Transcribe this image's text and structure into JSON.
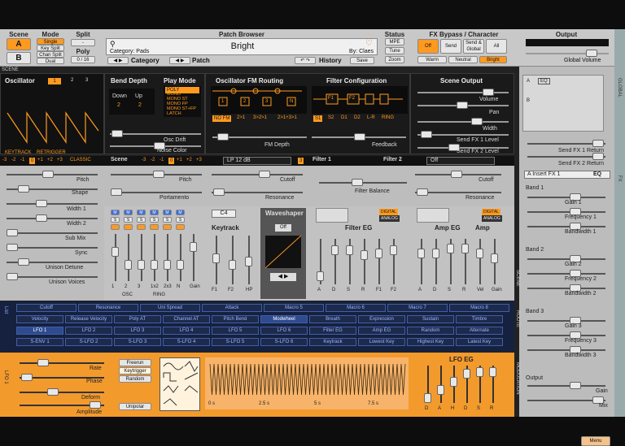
{
  "scene": {
    "title": "Scene",
    "a": "A",
    "b": "B"
  },
  "mode": {
    "title": "Mode",
    "options": [
      "Single",
      "Key Split",
      "Chan Split",
      "Dual"
    ]
  },
  "split": {
    "title": "Split",
    "value": "-",
    "poly_label": "Poly",
    "poly_value": "0 / 16"
  },
  "patch_browser": {
    "title": "Patch Browser",
    "patch_name": "Bright",
    "category_line": "Category: Pads",
    "author_line": "By: Claes",
    "category_label": "Category",
    "patch_label": "Patch",
    "history_label": "History",
    "save_label": "Save"
  },
  "status": {
    "title": "Status",
    "items": [
      "MPE",
      "Tune",
      "Zoom"
    ]
  },
  "fx_bypass": {
    "title": "FX Bypass / Character",
    "options": [
      "Off",
      "Send",
      "Send & Global",
      "All"
    ],
    "character": [
      "Warm",
      "Neutral",
      "Bright"
    ]
  },
  "output": {
    "title": "Output",
    "global_volume": "Global Volume"
  },
  "scene_strip_label": "SCENE",
  "oscillator": {
    "title": "Oscillator",
    "tabs": [
      "1",
      "2",
      "3"
    ],
    "keytrack": "KEYTRACK",
    "retrigger": "RETRIGGER",
    "octaves": [
      "-3",
      "-2",
      "-1",
      "0",
      "+1",
      "+2",
      "+3"
    ],
    "type": "CLASSIC",
    "params": [
      "Pitch",
      "Shape",
      "Width 1",
      "Width 2",
      "Sub Mix",
      "Sync",
      "Unison Detune",
      "Unison Voices"
    ]
  },
  "bend": {
    "title": "Bend Depth",
    "down": "Down",
    "up": "Up",
    "down_val": "2",
    "up_val": "2"
  },
  "play_mode": {
    "title": "Play Mode",
    "options": [
      "POLY",
      "MONO",
      "MONO ST",
      "MONO FP",
      "MONO ST+FP",
      "LATCH"
    ]
  },
  "osc_drift": "Osc Drift",
  "noise_color": "Noise Color",
  "fm_routing": {
    "title": "Oscillator FM Routing",
    "options": [
      "NO FM",
      "2>1",
      "3>2>1",
      "2>1+3>1"
    ],
    "fm_depth": "FM Depth",
    "nodes": [
      "1",
      "2",
      "3",
      "N"
    ]
  },
  "filter_config": {
    "title": "Filter Configuration",
    "options": [
      "S1",
      "S2",
      "D1",
      "D2",
      "L-R",
      "RING"
    ],
    "feedback": "Feedback",
    "nodes": [
      "F1",
      "F2"
    ]
  },
  "scene_output": {
    "title": "Scene Output",
    "params": [
      "Volume",
      "Pan",
      "Width",
      "Send FX 1 Level",
      "Send FX 2 Level"
    ]
  },
  "scene_bar": {
    "scene": "Scene",
    "octaves": [
      "-3",
      "-2",
      "-1",
      "0",
      "+1",
      "+2",
      "+3"
    ],
    "filter_type": "LP 12 dB",
    "filter_num": "3",
    "filter1": "Filter 1",
    "filter2": "Filter 2",
    "filter2_type": "Off"
  },
  "scene_params": {
    "pitch": "Pitch",
    "portamento": "Portamento",
    "cutoff": "Cutoff",
    "resonance": "Resonance",
    "filter_balance": "Filter Balance",
    "cutoff2": "Cutoff",
    "resonance2": "Resonance"
  },
  "mixer": {
    "m": "M",
    "s": "S",
    "labels": [
      "1",
      "2",
      "3",
      "1x2",
      "2x3",
      "N",
      "Gain"
    ],
    "osc": "OSC",
    "ring": "RING"
  },
  "keytrack": {
    "note": "C4",
    "title": "Keytrack",
    "labels": [
      "F1",
      "F2",
      "HP"
    ]
  },
  "waveshaper": {
    "title": "Waveshaper",
    "type": "Off"
  },
  "filter_eg": {
    "title": "Filter EG",
    "digital": "DIGITAL",
    "analog": "ANALOG",
    "labels": [
      "A",
      "D",
      "S",
      "R",
      "F1",
      "F2"
    ]
  },
  "amp_eg": {
    "title": "Amp EG",
    "subtitle": "Amp",
    "digital": "DIGITAL",
    "analog": "ANALOG",
    "labels": [
      "A",
      "D",
      "S",
      "R",
      "Vel",
      "Gain"
    ]
  },
  "fx": {
    "insert": "A Insert FX 1",
    "eq": "EQ",
    "bands": [
      {
        "name": "Band 1",
        "params": [
          "Gain 1",
          "Frequency 1",
          "Bandwidth 1"
        ]
      },
      {
        "name": "Band 2",
        "params": [
          "Gain 2",
          "Frequency 2",
          "Bandwidth 2"
        ]
      },
      {
        "name": "Band 3",
        "params": [
          "Gain 3",
          "Frequency 3",
          "Bandwidth 3"
        ]
      }
    ],
    "output": "Output",
    "gain": "Gain",
    "mix": "Mix",
    "send1": "Send FX 1 Return",
    "send2": "Send FX 2 Return",
    "menu": "Menu"
  },
  "mod_list": {
    "vertical": "List",
    "row1": [
      "Cutoff",
      "Resonance",
      "Uni Spread",
      "Attack",
      "Macro 5",
      "Macro 6",
      "Macro 7",
      "Macro 8"
    ],
    "row2": [
      "Velocity",
      "Release Velocity",
      "Poly AT",
      "Channel AT",
      "Pitch Bend",
      "Modwheel",
      "Breath",
      "Expression",
      "Sustain",
      "Timbre"
    ],
    "row3": [
      "LFO 1",
      "LFO 2",
      "LFO 3",
      "LFO 4",
      "LFO 5",
      "LFO 6",
      "Filter EG",
      "Amp EG",
      "Random",
      "Alternate"
    ],
    "row4": [
      "S-ENV 1",
      "S-LFO 2",
      "S-LFO 3",
      "S-LFO 4",
      "S-LFO 5",
      "S-LFO 6",
      "Keytrack",
      "Lowest Key",
      "Highest Key",
      "Latest Key"
    ]
  },
  "lfo": {
    "vertical": "LFO 1",
    "params": [
      "Rate",
      "Phase",
      "Deform",
      "Amplitude"
    ],
    "modes": [
      "Freerun",
      "Keytrigger",
      "Random"
    ],
    "unipolar": "Unipolar",
    "time_labels": [
      "0 s",
      "2.5 s",
      "5 s",
      "7.5 s"
    ],
    "eg_title": "LFO EG",
    "eg_labels": [
      "D",
      "A",
      "H",
      "D",
      "S",
      "R"
    ]
  },
  "side_labels": {
    "global": "GLOBAL",
    "fx": "FX",
    "scene": "SCENE",
    "route": "ROUTE",
    "modulation": "MODULATION"
  },
  "colors": {
    "accent": "#ff9a1f",
    "panel": "#1a1a1a",
    "mod_blue": "#2e4b8f",
    "bg": "#222222"
  }
}
